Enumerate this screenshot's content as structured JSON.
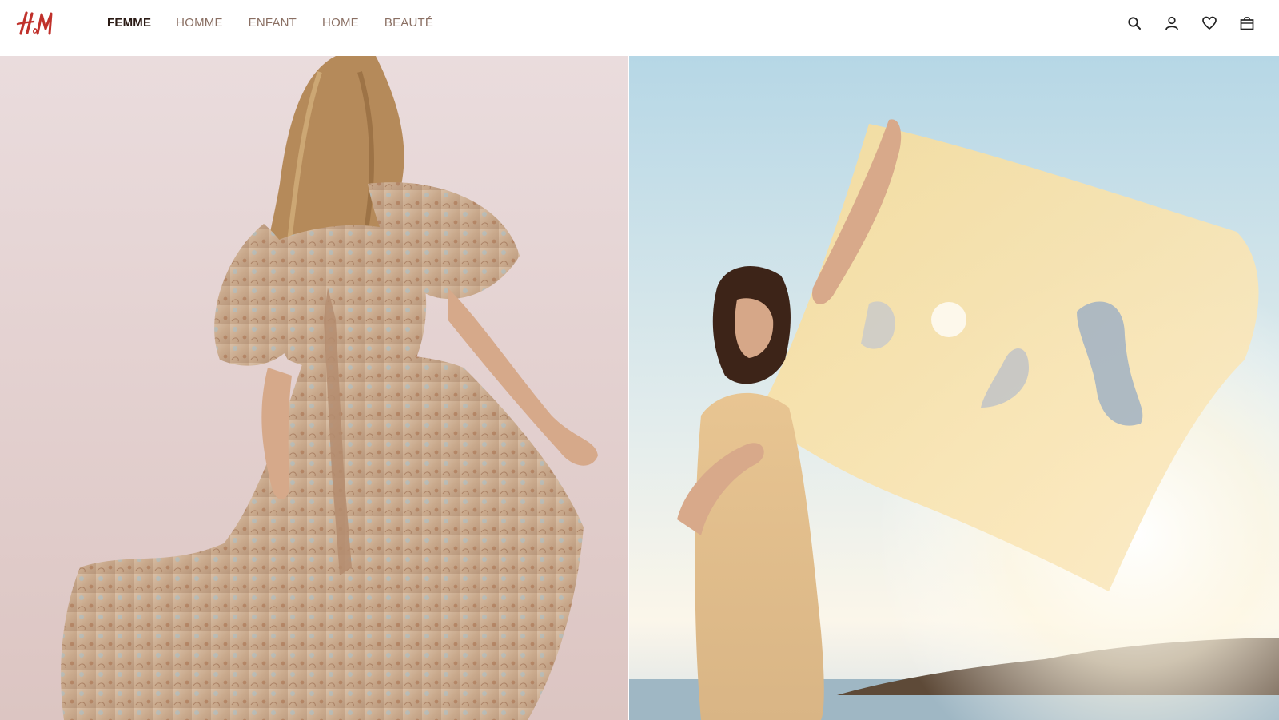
{
  "brand": {
    "logo_text": "H&M",
    "color": "#c0312b"
  },
  "nav": {
    "items": [
      {
        "label": "FEMME",
        "active": true
      },
      {
        "label": "HOMME",
        "active": false
      },
      {
        "label": "ENFANT",
        "active": false
      },
      {
        "label": "HOME",
        "active": false
      },
      {
        "label": "BEAUTÉ",
        "active": false
      }
    ]
  },
  "header_icons": [
    "search-icon",
    "account-icon",
    "favorites-icon",
    "bag-icon"
  ],
  "hero": {
    "left_image": "woman-in-paisley-dress",
    "right_image": "woman-with-yellow-scarf-at-beach"
  },
  "colors": {
    "nav_active": "#2a1a14",
    "nav_inactive": "#8a6f63",
    "icon": "#222222"
  }
}
